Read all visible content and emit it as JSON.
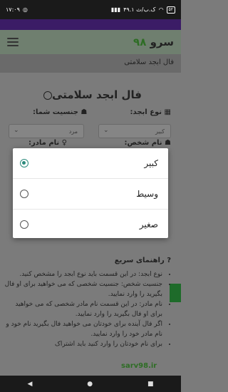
{
  "status": {
    "time": "۱۷:۰۹",
    "battery": "۵۲",
    "net_speed": "۴۹.۱ ک.ب/ث"
  },
  "app": {
    "logo_text": "سرو",
    "logo_num": "۹۸"
  },
  "breadcrumb": "فال ابجد سلامتی",
  "page": {
    "title": "فال ابجد سلامتی",
    "abjad_type_label": "نوع ابجد:",
    "gender_label": "جنسیت شما:",
    "abjad_selected": "کبیر",
    "gender_selected": "مرد",
    "person_name_label": "نام شخص:",
    "mother_name_label": "نام مادر:"
  },
  "help": {
    "title": "راهنمای سریع",
    "items": [
      "نوع ابجد: در این قسمت باید نوع ابجد را مشخص کنید.",
      "جنسیت شخص: جنسیت شخصی که می خواهید برای او فال بگیرید را وارد نمایید.",
      "نام مادر: در این قسمت نام مادر شخصی که می خواهید برای او فال بگیرید را وارد نمایید.",
      "اگر فال آینده برای خودتان می خواهید فال بگیرید نام خود و نام مادر خود را وارد نمایید.",
      "برای نام خودتان را وارد کنید باید اشتراک"
    ]
  },
  "dialog": {
    "options": [
      {
        "label": "کبیر",
        "checked": true
      },
      {
        "label": "وسیط",
        "checked": false
      },
      {
        "label": "صغیر",
        "checked": false
      }
    ]
  },
  "watermark": "sarv98.ir",
  "colors": {
    "accent": "#2c8b7c",
    "brand_green": "#2e6d25"
  }
}
